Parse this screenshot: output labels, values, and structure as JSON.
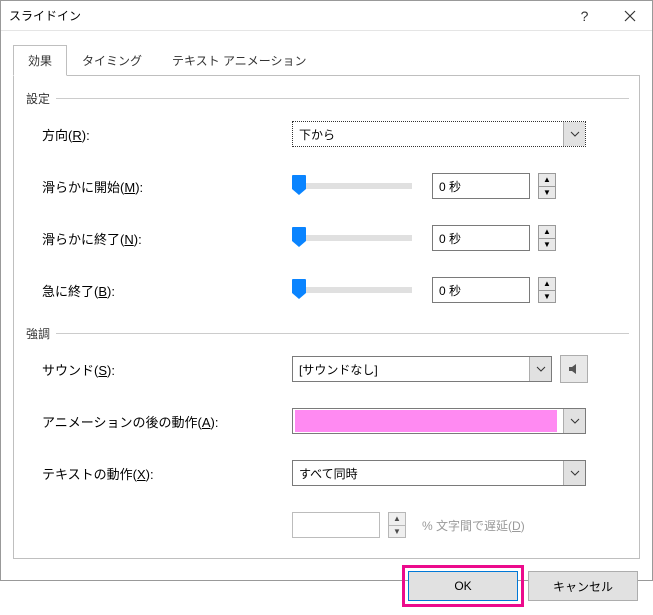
{
  "window": {
    "title": "スライドイン"
  },
  "tabs": {
    "effect": "効果",
    "timing": "タイミング",
    "textAnim": "テキスト アニメーション"
  },
  "groups": {
    "settings": "設定",
    "emphasis": "強調"
  },
  "labels": {
    "direction": "方向(R):",
    "smoothStart": "滑らかに開始(M):",
    "smoothEnd": "滑らかに終了(N):",
    "bounceEnd": "急に終了(B):",
    "sound": "サウンド(S):",
    "afterAnim": "アニメーションの後の動作(A):",
    "textAnim": "テキストの動作(X):",
    "delayPct": "% 文字間で遅延(D)"
  },
  "values": {
    "direction": "下から",
    "smoothStart": "0 秒",
    "smoothEnd": "0 秒",
    "bounceEnd": "0 秒",
    "sound": "[サウンドなし]",
    "afterAnimColor": "#ff8af2",
    "textAnim": "すべて同時",
    "delayPct": ""
  },
  "buttons": {
    "ok": "OK",
    "cancel": "キャンセル"
  }
}
